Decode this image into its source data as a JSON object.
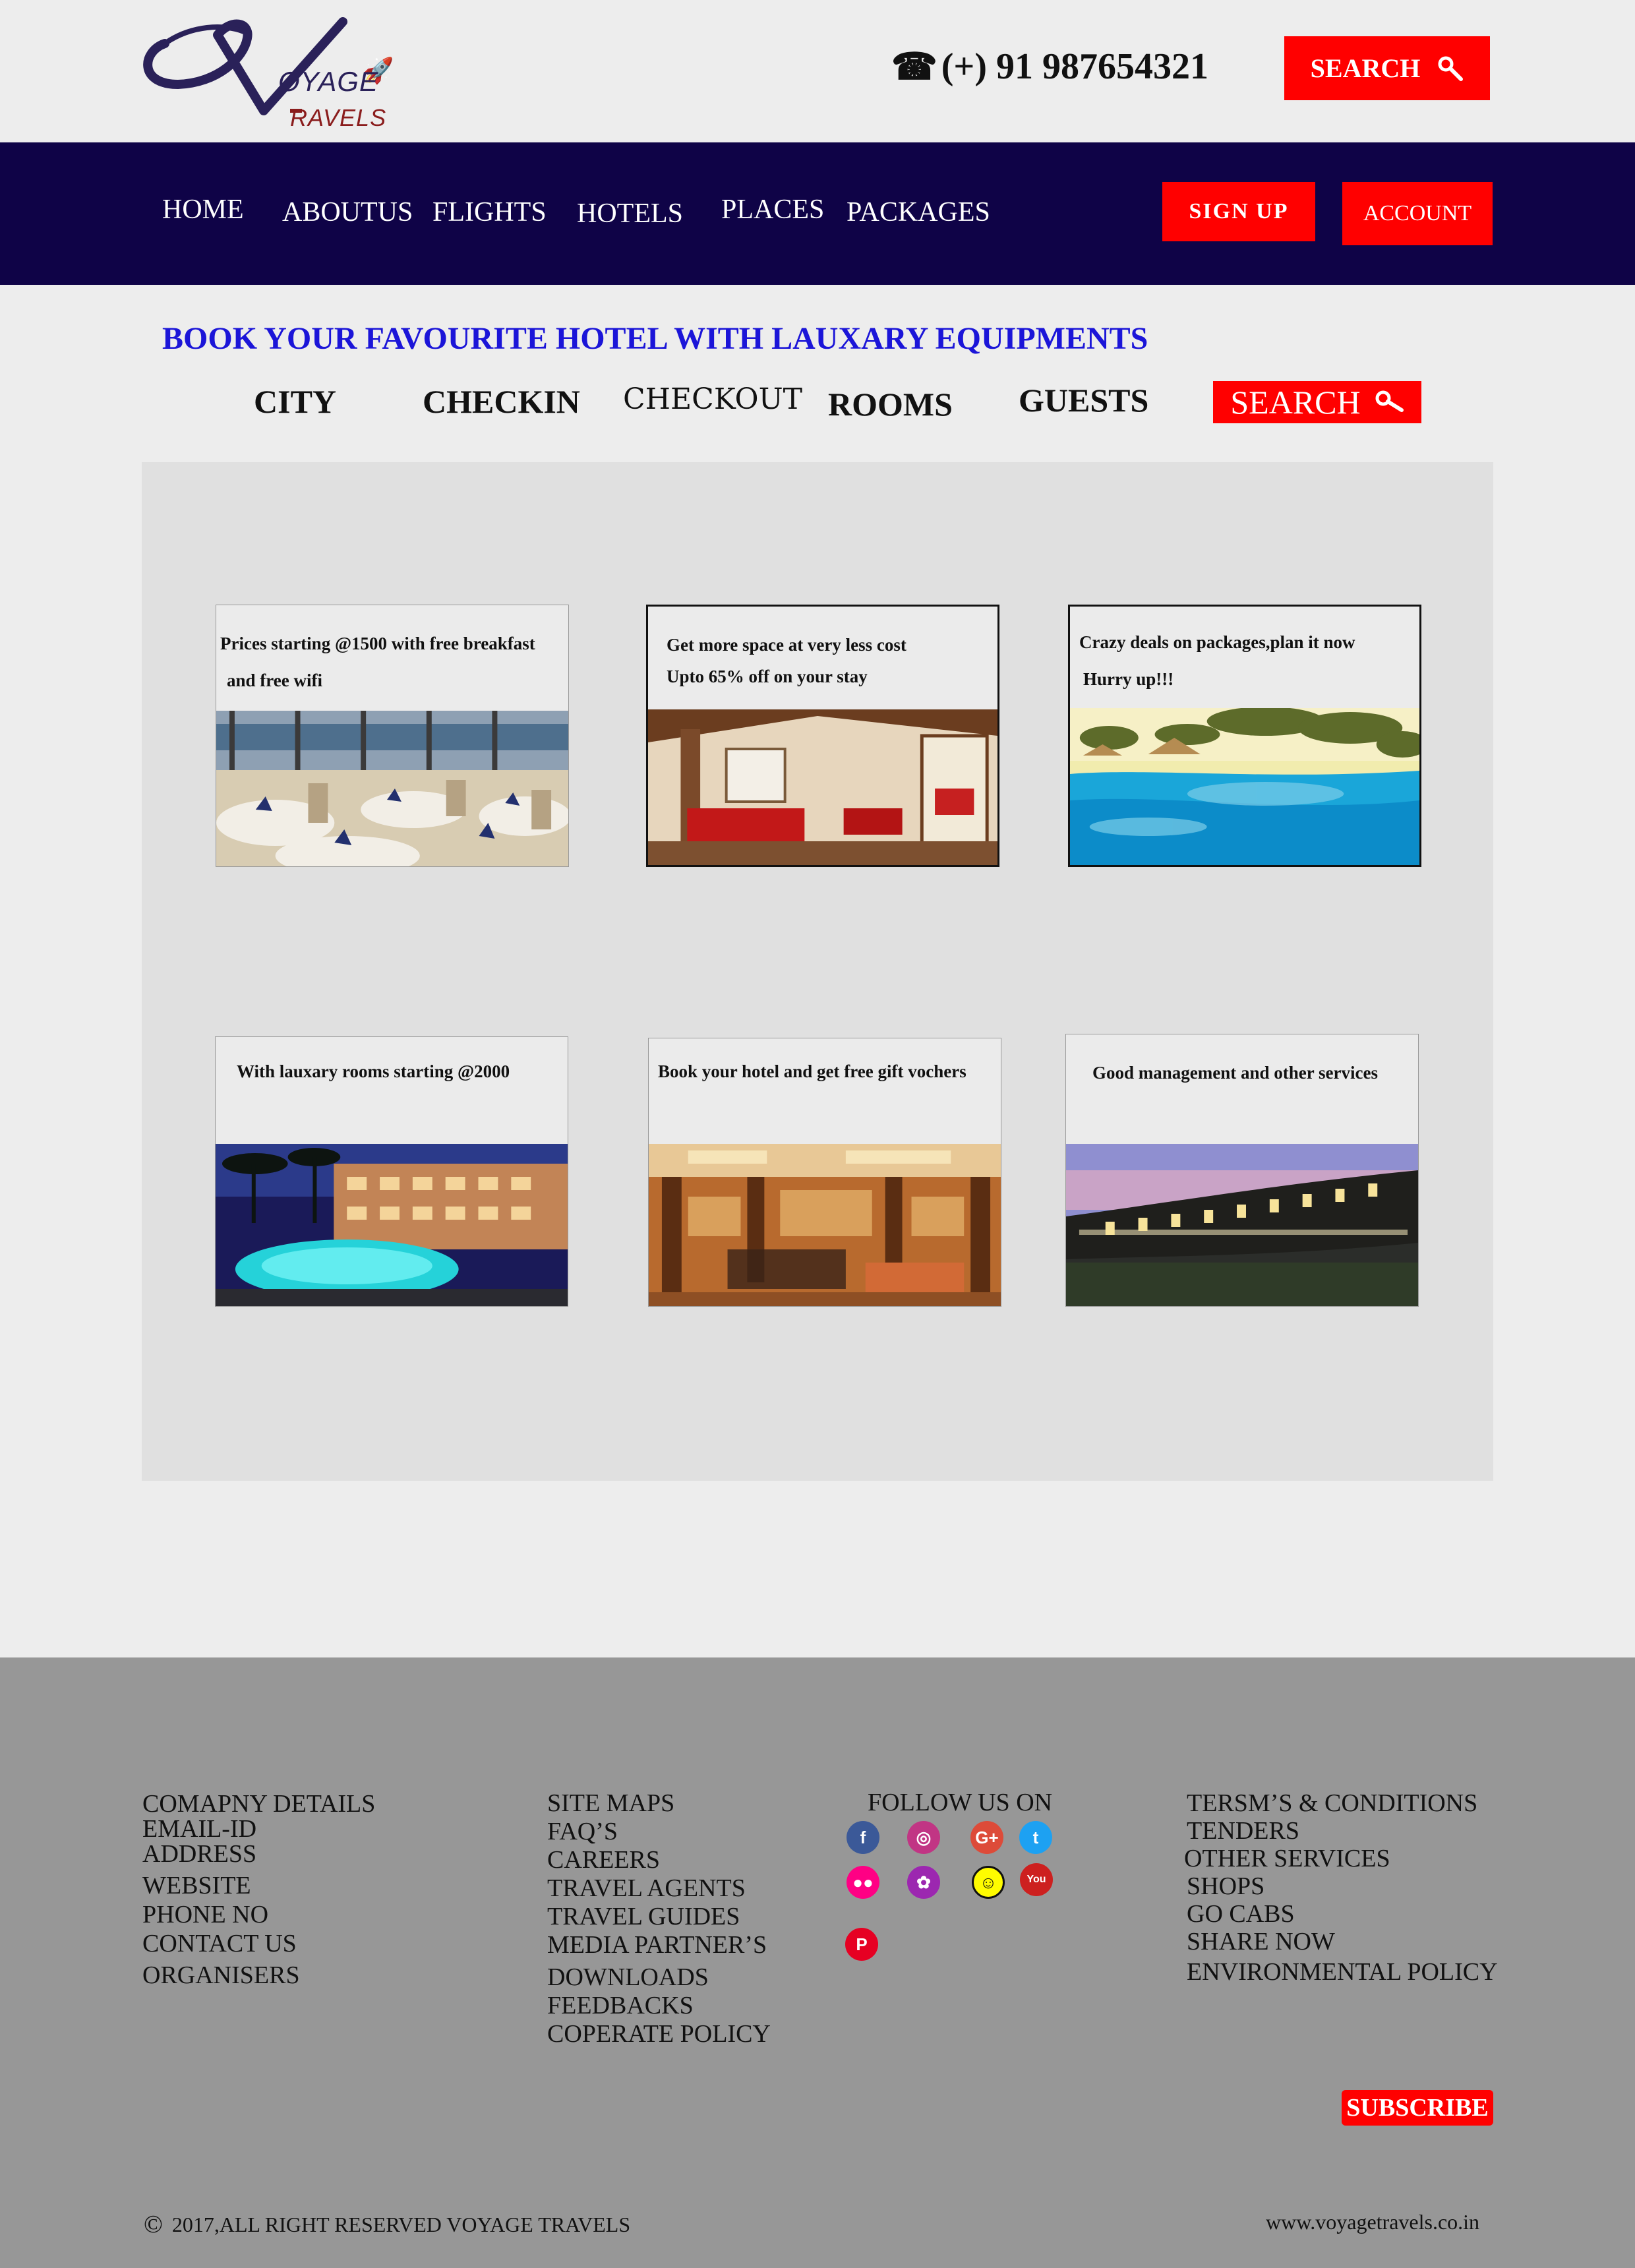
{
  "logo": {
    "line1": "OYAGE",
    "line2": "RAVELS"
  },
  "header": {
    "phone": "(+) 91 987654321",
    "search_label": "SEARCH"
  },
  "nav": {
    "items": [
      "HOME",
      "ABOUTUS",
      "FLIGHTS",
      "HOTELS",
      "PLACES",
      "PACKAGES"
    ],
    "signup_label": "SIGN UP",
    "account_label": "ACCOUNT"
  },
  "booking": {
    "headline": "BOOK YOUR FAVOURITE HOTEL WITH LAUXARY EQUIPMENTS",
    "fields": [
      "CITY",
      "CHECKIN",
      "CHECKOUT",
      "ROOMS",
      "GUESTS"
    ],
    "search_label": "SEARCH"
  },
  "cards": [
    {
      "line1": "Prices starting @1500 with free breakfast",
      "line2": "and free wifi"
    },
    {
      "line1": "Get more space at very less cost",
      "line2": "Upto 65% off on your stay"
    },
    {
      "line1": "Crazy deals on packages,plan it now",
      "line2": "Hurry up!!!"
    },
    {
      "line1": "With lauxary rooms starting @2000",
      "line2": ""
    },
    {
      "line1": "Book your hotel and get free gift vochers",
      "line2": ""
    },
    {
      "line1": "Good management and other services",
      "line2": ""
    }
  ],
  "footer": {
    "col1": [
      "COMAPNY DETAILS",
      "EMAIL-ID",
      "ADDRESS",
      "WEBSITE",
      "PHONE NO",
      "CONTACT US",
      "ORGANISERS"
    ],
    "col2": [
      "SITE MAPS",
      "FAQ’S",
      "CAREERS",
      "TRAVEL AGENTS",
      "TRAVEL GUIDES",
      "MEDIA PARTNER’S",
      "DOWNLOADS",
      "FEEDBACKS",
      "COPERATE POLICY"
    ],
    "follow_title": "FOLLOW US ON",
    "social": [
      {
        "icon": "facebook-icon",
        "glyph": "f",
        "color": "#3b5998"
      },
      {
        "icon": "instagram-icon",
        "glyph": "◎",
        "color": "#c13584"
      },
      {
        "icon": "google-plus-icon",
        "glyph": "G+",
        "color": "#dd4b39"
      },
      {
        "icon": "twitter-icon",
        "glyph": "t",
        "color": "#1da1f2"
      },
      {
        "icon": "flickr-icon",
        "glyph": "●●",
        "color": "#ff0084"
      },
      {
        "icon": "picasa-icon",
        "glyph": "✿",
        "color": "#9c27b0"
      },
      {
        "icon": "snapchat-icon",
        "glyph": "☺",
        "color": "#fffc00"
      },
      {
        "icon": "youtube-icon",
        "glyph": "You",
        "color": "#cd201f"
      },
      {
        "icon": "pinterest-icon",
        "glyph": "P",
        "color": "#e60023"
      }
    ],
    "col4": [
      "TERSM’S & CONDITIONS",
      "TENDERS",
      "OTHER SERVICES",
      "SHOPS",
      "GO CABS",
      "SHARE NOW",
      "ENVIRONMENTAL POLICY"
    ],
    "subscribe_label": "SUBSCRIBE",
    "copyright": "2017,ALL RIGHT RESERVED VOYAGE TRAVELS",
    "website": "www.voyagetravels.co.in"
  }
}
